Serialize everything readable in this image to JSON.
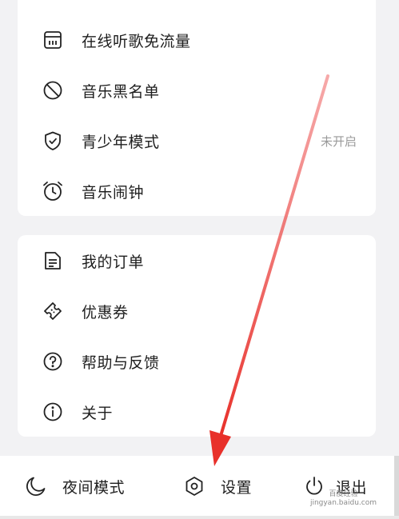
{
  "menu_group_1": [
    {
      "label": "在线听歌免流量",
      "icon": "sim-card-icon",
      "value": ""
    },
    {
      "label": "音乐黑名单",
      "icon": "block-icon",
      "value": ""
    },
    {
      "label": "青少年模式",
      "icon": "shield-check-icon",
      "value": "未开启"
    },
    {
      "label": "音乐闹钟",
      "icon": "alarm-clock-icon",
      "value": ""
    }
  ],
  "menu_group_2": [
    {
      "label": "我的订单",
      "icon": "document-icon"
    },
    {
      "label": "优惠券",
      "icon": "ticket-icon"
    },
    {
      "label": "帮助与反馈",
      "icon": "help-icon"
    },
    {
      "label": "关于",
      "icon": "info-icon"
    }
  ],
  "bottom_bar": {
    "night_mode": "夜间模式",
    "settings": "设置",
    "logout": "退出"
  },
  "watermark": {
    "line1": "百度经验",
    "line2": "jingyan.baidu.com"
  },
  "colors": {
    "annotation_arrow": "#e8302a",
    "card_bg": "#ffffff",
    "page_bg": "#f2f2f4",
    "secondary_text": "#9a9a9a"
  }
}
